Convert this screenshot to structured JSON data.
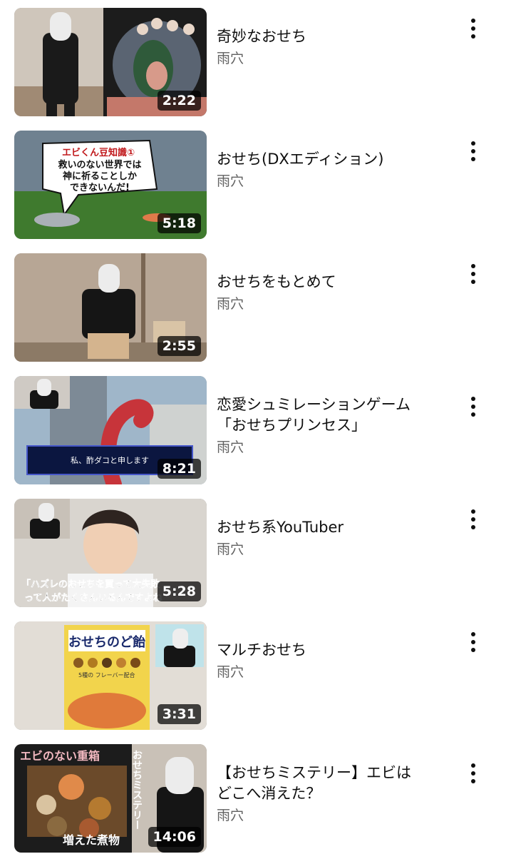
{
  "videos": [
    {
      "title": "奇妙なおせち",
      "channel": "雨穴",
      "duration": "2:22"
    },
    {
      "title": "おせち(DXエディション)",
      "channel": "雨穴",
      "duration": "5:18",
      "thumb_text": {
        "line1": "エビくん豆知識①",
        "line2": "救いのない世界では",
        "line3": "神に祈ることしか",
        "line4": "できないんだ!"
      }
    },
    {
      "title": "おせちをもとめて",
      "channel": "雨穴",
      "duration": "2:55"
    },
    {
      "title": "恋愛シュミレーションゲーム\n「おせちプリンセス」",
      "channel": "雨穴",
      "duration": "8:21",
      "thumb_text": {
        "caption": "私、酢ダコと申します"
      }
    },
    {
      "title": "おせち系YouTuber",
      "channel": "雨穴",
      "duration": "5:28",
      "thumb_text": {
        "line1": "「ハズレのおせちを買って大失敗",
        "line2": "って人がたくさんいるんですよね"
      }
    },
    {
      "title": "マルチおせち",
      "channel": "雨穴",
      "duration": "3:31",
      "thumb_text": {
        "package": "おせちのど飴",
        "sub": "5種の フレーバー配合"
      }
    },
    {
      "title": "【おせちミステリー】エビは\nどこへ消えた？",
      "channel": "雨穴",
      "duration": "14:06",
      "thumb_text": {
        "top": "エビのない重箱",
        "bottom": "増えた煮物",
        "side": "おせちミステリー"
      }
    }
  ],
  "icons": {
    "menu": "more-vert-icon"
  }
}
